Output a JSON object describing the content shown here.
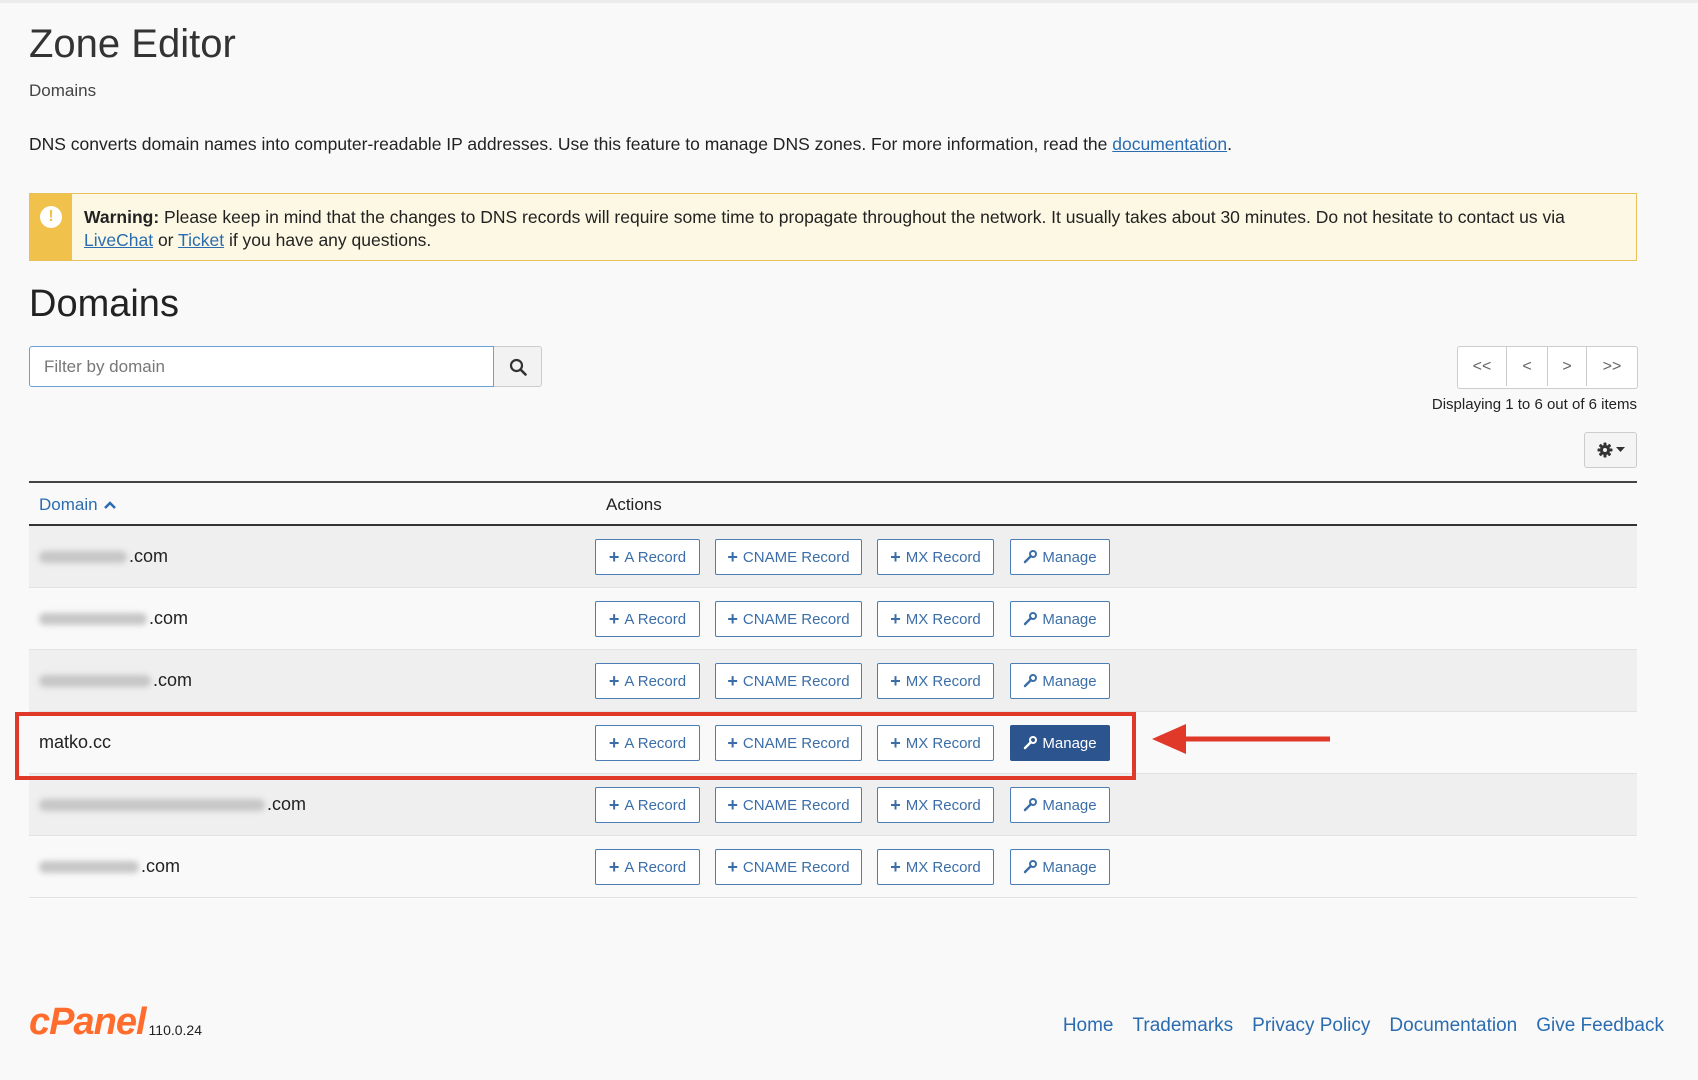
{
  "header": {
    "title": "Zone Editor",
    "breadcrumb": "Domains",
    "intro_text": "DNS converts domain names into computer-readable IP addresses. Use this feature to manage DNS zones. For more information, read the ",
    "intro_link": "documentation",
    "intro_end": "."
  },
  "warning": {
    "label": "Warning:",
    "text": " Please keep in mind that the changes to DNS records will require some time to propagate throughout the network. It usually takes about 30 minutes. Do not hesitate to contact us via ",
    "link1": "LiveChat",
    "mid": " or ",
    "link2": "Ticket",
    "end": " if you have any questions."
  },
  "domains": {
    "title": "Domains",
    "search_placeholder": "Filter by domain",
    "pagination": {
      "first": "<<",
      "prev": "<",
      "next": ">",
      "last": ">>"
    },
    "display_count": "Displaying 1 to 6 out of 6 items",
    "columns": {
      "domain": "Domain",
      "actions": "Actions"
    },
    "buttons": {
      "a_record": "A Record",
      "cname_record": "CNAME Record",
      "mx_record": "MX Record",
      "manage": "Manage"
    },
    "rows": [
      {
        "domain": ".com",
        "blurred": true,
        "highlighted": false
      },
      {
        "domain": ".com",
        "blurred": true,
        "highlighted": false
      },
      {
        "domain": ".com",
        "blurred": true,
        "highlighted": false
      },
      {
        "domain": "matko.cc",
        "blurred": false,
        "highlighted": true
      },
      {
        "domain": ".com",
        "blurred": true,
        "highlighted": false
      },
      {
        "domain": ".com",
        "blurred": true,
        "highlighted": false
      }
    ]
  },
  "footer": {
    "logo": "cPanel",
    "version": "110.0.24",
    "links": [
      "Home",
      "Trademarks",
      "Privacy Policy",
      "Documentation",
      "Give Feedback"
    ]
  },
  "colors": {
    "accent": "#2b6cb0",
    "annotation": "#e0392a",
    "warning_bg": "#fcf8e3",
    "logo": "#ff6c2c"
  }
}
